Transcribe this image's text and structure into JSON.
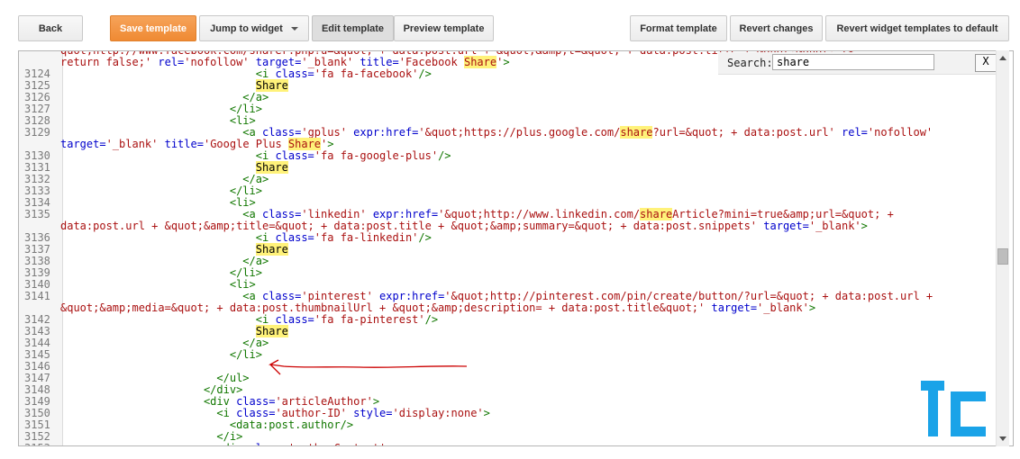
{
  "toolbar": {
    "back": "Back",
    "save": "Save template",
    "jump": "Jump to widget",
    "edit": "Edit template",
    "preview": "Preview template",
    "format": "Format template",
    "revert": "Revert changes",
    "revert_widgets": "Revert widget templates to default"
  },
  "search": {
    "label": "Search:",
    "value": "share",
    "close": "X"
  },
  "colors": {
    "accent": "#ef8a33",
    "tag": "#117700",
    "attribute": "#0000cc",
    "string": "#aa1111",
    "highlight": "#fff27a",
    "annotation": "#cc0000",
    "logo": "#1aa3e8"
  },
  "logo": {
    "icon": "tc-logo-icon"
  },
  "code_lines": [
    {
      "n": "",
      "t": [
        [
          "s",
          "quot;http://www.facebook.com/sharer.php?u=&quot; + data:post.url + &quot;&amp;t=&quot; + data:post.title + &quot;&quot;\"/>"
        ]
      ]
    },
    {
      "n": "",
      "t": [
        [
          "s",
          "return false;' "
        ],
        [
          "a",
          "rel="
        ],
        [
          "s",
          "'nofollow' "
        ],
        [
          "a",
          "target="
        ],
        [
          "s",
          "'_blank' "
        ],
        [
          "a",
          "title="
        ],
        [
          "s",
          "'Facebook "
        ],
        [
          "hs",
          "Share"
        ],
        [
          "s",
          "'"
        ],
        [
          "g",
          ">"
        ]
      ]
    },
    {
      "n": "3124",
      "t": [
        [
          "p",
          "                              "
        ],
        [
          "g",
          "<i "
        ],
        [
          "a",
          "class="
        ],
        [
          "s",
          "'fa fa-facebook'"
        ],
        [
          "g",
          "/>"
        ]
      ]
    },
    {
      "n": "3125",
      "t": [
        [
          "p",
          "                              "
        ],
        [
          "hp",
          "Share"
        ]
      ]
    },
    {
      "n": "3126",
      "t": [
        [
          "p",
          "                            "
        ],
        [
          "g",
          "</a>"
        ]
      ]
    },
    {
      "n": "3127",
      "t": [
        [
          "p",
          "                          "
        ],
        [
          "g",
          "</li>"
        ]
      ]
    },
    {
      "n": "3128",
      "t": [
        [
          "p",
          "                          "
        ],
        [
          "g",
          "<li>"
        ]
      ]
    },
    {
      "n": "3129",
      "t": [
        [
          "p",
          "                            "
        ],
        [
          "g",
          "<a "
        ],
        [
          "a",
          "class="
        ],
        [
          "s",
          "'gplus' "
        ],
        [
          "a",
          "expr:href="
        ],
        [
          "s",
          "'&quot;https://plus.google.com/"
        ],
        [
          "hs",
          "share"
        ],
        [
          "s",
          "?url=&quot; + data:post.url' "
        ],
        [
          "a",
          "rel="
        ],
        [
          "s",
          "'nofollow'"
        ]
      ]
    },
    {
      "n": "",
      "t": [
        [
          "a",
          "target="
        ],
        [
          "s",
          "'_blank' "
        ],
        [
          "a",
          "title="
        ],
        [
          "s",
          "'Google Plus "
        ],
        [
          "hs",
          "Share"
        ],
        [
          "s",
          "'"
        ],
        [
          "g",
          ">"
        ]
      ]
    },
    {
      "n": "3130",
      "t": [
        [
          "p",
          "                              "
        ],
        [
          "g",
          "<i "
        ],
        [
          "a",
          "class="
        ],
        [
          "s",
          "'fa fa-google-plus'"
        ],
        [
          "g",
          "/>"
        ]
      ]
    },
    {
      "n": "3131",
      "t": [
        [
          "p",
          "                              "
        ],
        [
          "hp",
          "Share"
        ]
      ]
    },
    {
      "n": "3132",
      "t": [
        [
          "p",
          "                            "
        ],
        [
          "g",
          "</a>"
        ]
      ]
    },
    {
      "n": "3133",
      "t": [
        [
          "p",
          "                          "
        ],
        [
          "g",
          "</li>"
        ]
      ]
    },
    {
      "n": "3134",
      "t": [
        [
          "p",
          "                          "
        ],
        [
          "g",
          "<li>"
        ]
      ]
    },
    {
      "n": "3135",
      "t": [
        [
          "p",
          "                            "
        ],
        [
          "g",
          "<a "
        ],
        [
          "a",
          "class="
        ],
        [
          "s",
          "'linkedin' "
        ],
        [
          "a",
          "expr:href="
        ],
        [
          "s",
          "'&quot;http://www.linkedin.com/"
        ],
        [
          "hs",
          "share"
        ],
        [
          "s",
          "Article?mini=true&amp;url=&quot; +"
        ]
      ]
    },
    {
      "n": "",
      "t": [
        [
          "s",
          "data:post.url + &quot;&amp;title=&quot; + data:post.title + &quot;&amp;summary=&quot; + data:post.snippets' "
        ],
        [
          "a",
          "target="
        ],
        [
          "s",
          "'_blank'"
        ],
        [
          "g",
          ">"
        ]
      ]
    },
    {
      "n": "3136",
      "t": [
        [
          "p",
          "                              "
        ],
        [
          "g",
          "<i "
        ],
        [
          "a",
          "class="
        ],
        [
          "s",
          "'fa fa-linkedin'"
        ],
        [
          "g",
          "/>"
        ]
      ]
    },
    {
      "n": "3137",
      "t": [
        [
          "p",
          "                              "
        ],
        [
          "hp",
          "Share"
        ]
      ]
    },
    {
      "n": "3138",
      "t": [
        [
          "p",
          "                            "
        ],
        [
          "g",
          "</a>"
        ]
      ]
    },
    {
      "n": "3139",
      "t": [
        [
          "p",
          "                          "
        ],
        [
          "g",
          "</li>"
        ]
      ]
    },
    {
      "n": "3140",
      "t": [
        [
          "p",
          "                          "
        ],
        [
          "g",
          "<li>"
        ]
      ]
    },
    {
      "n": "3141",
      "t": [
        [
          "p",
          "                            "
        ],
        [
          "g",
          "<a "
        ],
        [
          "a",
          "class="
        ],
        [
          "s",
          "'pinterest' "
        ],
        [
          "a",
          "expr:href="
        ],
        [
          "s",
          "'&quot;http://pinterest.com/pin/create/button/?url=&quot; + data:post.url +"
        ]
      ]
    },
    {
      "n": "",
      "t": [
        [
          "s",
          "&quot;&amp;media=&quot; + data:post.thumbnailUrl + &quot;&amp;description= + data:post.title&quot;' "
        ],
        [
          "a",
          "target="
        ],
        [
          "s",
          "'_blank'"
        ],
        [
          "g",
          ">"
        ]
      ]
    },
    {
      "n": "3142",
      "t": [
        [
          "p",
          "                              "
        ],
        [
          "g",
          "<i "
        ],
        [
          "a",
          "class="
        ],
        [
          "s",
          "'fa fa-pinterest'"
        ],
        [
          "g",
          "/>"
        ]
      ]
    },
    {
      "n": "3143",
      "t": [
        [
          "p",
          "                              "
        ],
        [
          "hp",
          "Share"
        ]
      ]
    },
    {
      "n": "3144",
      "t": [
        [
          "p",
          "                            "
        ],
        [
          "g",
          "</a>"
        ]
      ]
    },
    {
      "n": "3145",
      "t": [
        [
          "p",
          "                          "
        ],
        [
          "g",
          "</li>"
        ]
      ]
    },
    {
      "n": "3146",
      "t": []
    },
    {
      "n": "3147",
      "t": [
        [
          "p",
          "                        "
        ],
        [
          "g",
          "</ul>"
        ]
      ]
    },
    {
      "n": "3148",
      "t": [
        [
          "p",
          "                      "
        ],
        [
          "g",
          "</div>"
        ]
      ]
    },
    {
      "n": "3149",
      "t": [
        [
          "p",
          "                      "
        ],
        [
          "g",
          "<div "
        ],
        [
          "a",
          "class="
        ],
        [
          "s",
          "'articleAuthor'"
        ],
        [
          "g",
          ">"
        ]
      ]
    },
    {
      "n": "3150",
      "t": [
        [
          "p",
          "                        "
        ],
        [
          "g",
          "<i "
        ],
        [
          "a",
          "class="
        ],
        [
          "s",
          "'author-ID' "
        ],
        [
          "a",
          "style="
        ],
        [
          "s",
          "'display:none'"
        ],
        [
          "g",
          ">"
        ]
      ]
    },
    {
      "n": "3151",
      "t": [
        [
          "p",
          "                          "
        ],
        [
          "g",
          "<data:post.author/>"
        ]
      ]
    },
    {
      "n": "3152",
      "t": [
        [
          "p",
          "                        "
        ],
        [
          "g",
          "</i>"
        ]
      ]
    },
    {
      "n": "3153",
      "t": [
        [
          "p",
          "                        "
        ],
        [
          "g",
          "<div "
        ],
        [
          "a",
          "class="
        ],
        [
          "s",
          "'authorContent'"
        ],
        [
          "g",
          ">"
        ]
      ]
    }
  ]
}
